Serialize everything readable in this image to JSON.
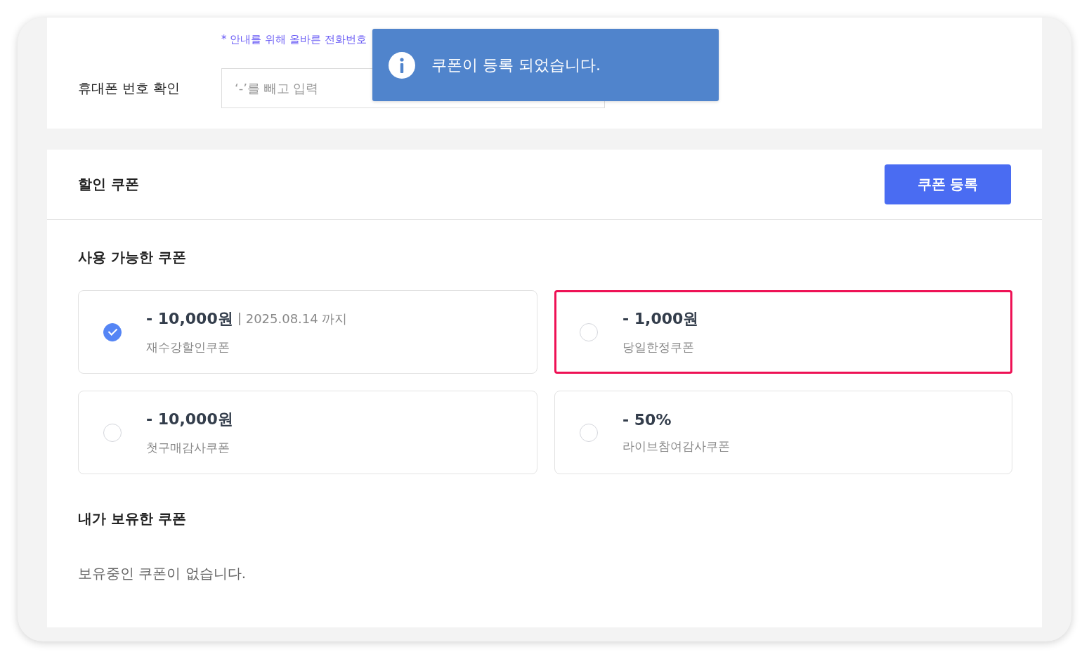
{
  "contact": {
    "hint": "* 안내를 위해 올바른 전화번호",
    "label": "휴대폰 번호 확인",
    "placeholder": "‘-’를 빼고 입력"
  },
  "toast": {
    "message": "쿠폰이 등록 되었습니다."
  },
  "coupon_section": {
    "title": "할인 쿠폰",
    "register_button": "쿠폰 등록",
    "available_title": "사용 가능한 쿠폰",
    "coupons": [
      {
        "amount": "- 10,000원",
        "expiry": "2025.08.14 까지",
        "name": "재수강할인쿠폰",
        "selected": true,
        "highlighted": false
      },
      {
        "amount": "- 1,000원",
        "name": "당일한정쿠폰",
        "selected": false,
        "highlighted": true
      },
      {
        "amount": "- 10,000원",
        "name": "첫구매감사쿠폰",
        "selected": false,
        "highlighted": false
      },
      {
        "amount": "- 50%",
        "name": "라이브참여감사쿠폰",
        "selected": false,
        "highlighted": false
      }
    ],
    "owned_title": "내가 보유한 쿠폰",
    "owned_empty": "보유중인 쿠폰이 없습니다."
  }
}
